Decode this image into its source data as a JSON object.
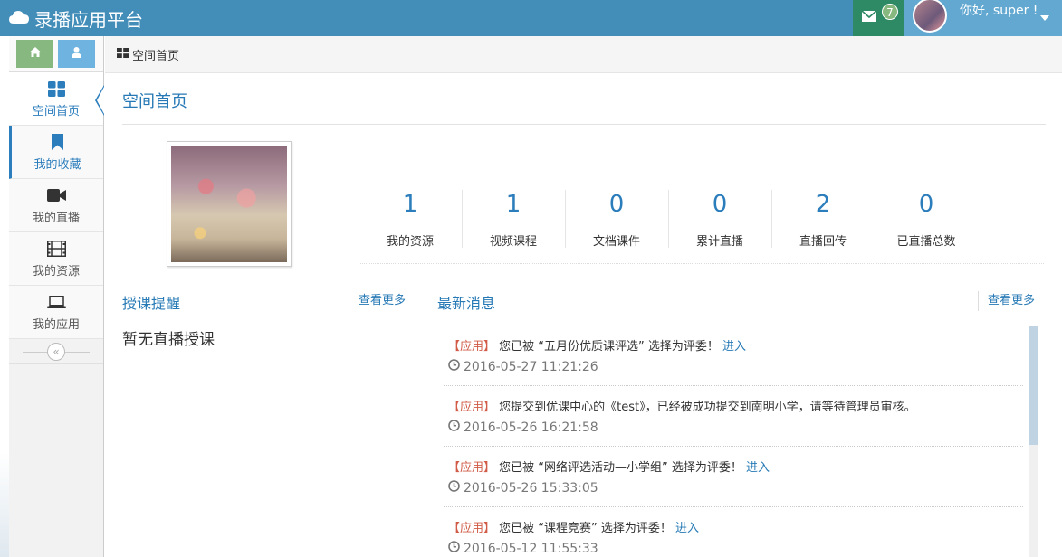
{
  "app": {
    "title": "录播应用平台"
  },
  "header": {
    "mail_count": "7",
    "greeting": "你好, super !"
  },
  "sidebar": {
    "items": [
      {
        "label": "空间首页",
        "icon": "dashboard-icon"
      },
      {
        "label": "我的收藏",
        "icon": "bookmark-icon"
      },
      {
        "label": "我的直播",
        "icon": "video-camera-icon"
      },
      {
        "label": "我的资源",
        "icon": "film-icon"
      },
      {
        "label": "我的应用",
        "icon": "laptop-icon"
      }
    ],
    "collapse_glyph": "«"
  },
  "breadcrumb": {
    "label": "空间首页"
  },
  "main": {
    "title": "空间首页",
    "stats": [
      {
        "value": "1",
        "label": "我的资源"
      },
      {
        "value": "1",
        "label": "视频课程"
      },
      {
        "value": "0",
        "label": "文档课件"
      },
      {
        "value": "0",
        "label": "累计直播"
      },
      {
        "value": "2",
        "label": "直播回传"
      },
      {
        "value": "0",
        "label": "已直播总数"
      }
    ],
    "reminders": {
      "title": "授课提醒",
      "more": "查看更多",
      "empty": "暂无直播授课"
    },
    "news": {
      "title": "最新消息",
      "more": "查看更多",
      "items": [
        {
          "tag": "【应用】",
          "text": " 您已被 “五月份优质课评选” 选择为评委！",
          "link": "进入",
          "time": "2016-05-27 11:21:26"
        },
        {
          "tag": "【应用】",
          "text": " 您提交到优课中心的《test》，已经被成功提交到南明小学，请等待管理员审核。",
          "link": "",
          "time": "2016-05-26 16:21:58"
        },
        {
          "tag": "【应用】",
          "text": " 您已被 “网络评选活动—小学组” 选择为评委！",
          "link": "进入",
          "time": "2016-05-26 15:33:05"
        },
        {
          "tag": "【应用】",
          "text": " 您已被 “课程竞赛” 选择为评委！",
          "link": "进入",
          "time": "2016-05-12 11:55:33"
        }
      ]
    }
  },
  "colors": {
    "header": "#438eb9",
    "accent": "#2679b5",
    "tag": "#d15b47",
    "mail_bg": "#2e8965",
    "user_bg": "#62a8d1"
  }
}
